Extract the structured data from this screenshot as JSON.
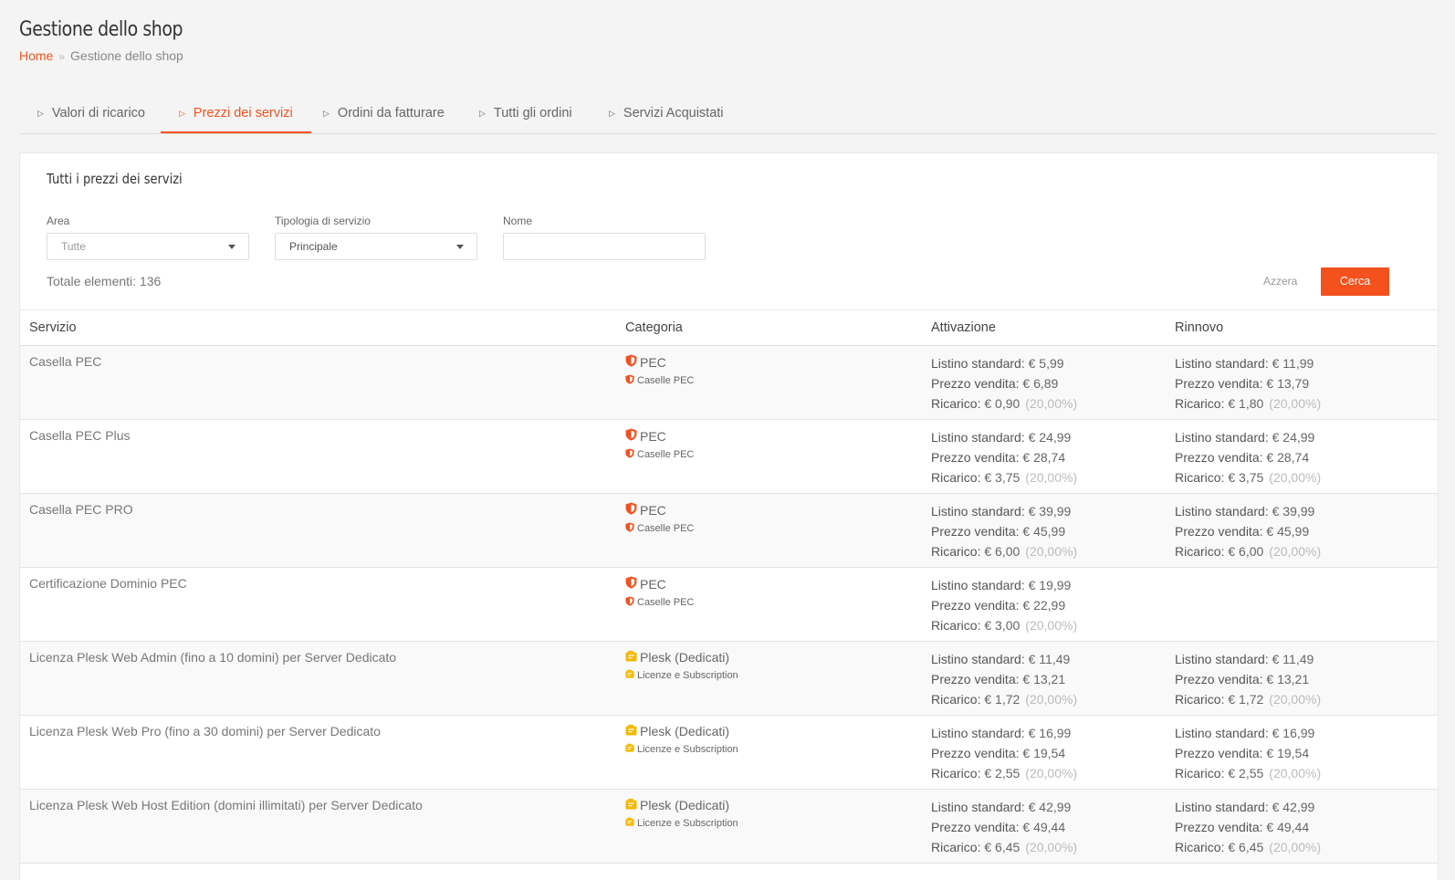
{
  "header": {
    "title": "Gestione dello shop",
    "breadcrumb": {
      "home": "Home",
      "separator": "»",
      "current": "Gestione dello shop"
    }
  },
  "tabs": [
    {
      "label": "Valori di ricarico",
      "active": false
    },
    {
      "label": "Prezzi dei servizi",
      "active": true
    },
    {
      "label": "Ordini da fatturare",
      "active": false
    },
    {
      "label": "Tutti gli ordini",
      "active": false
    },
    {
      "label": "Servizi Acquistati",
      "active": false
    }
  ],
  "card": {
    "title": "Tutti i prezzi dei servizi"
  },
  "filters": {
    "area": {
      "label": "Area",
      "value": "Tutte"
    },
    "tipologia": {
      "label": "Tipologia di servizio",
      "value": "Principale"
    },
    "nome": {
      "label": "Nome",
      "value": "",
      "placeholder": ""
    }
  },
  "summary": {
    "total_label": "Totale elementi:",
    "total_count": "136"
  },
  "actions": {
    "reset_label": "Azzera",
    "search_label": "Cerca"
  },
  "colors": {
    "accent": "#f4511e",
    "pec_icon": "#f4511e",
    "plesk_icon": "#f5b800"
  },
  "table": {
    "columns": [
      "Servizio",
      "Categoria",
      "Attivazione",
      "Rinnovo"
    ],
    "price_labels": {
      "listino": "Listino standard:",
      "vendita": "Prezzo vendita:",
      "ricarico": "Ricarico:"
    },
    "rows": [
      {
        "servizio": "Casella PEC",
        "categoria": "PEC",
        "sottocategoria": "Caselle PEC",
        "icon": "shield-icon",
        "attivazione": {
          "listino": "€ 5,99",
          "vendita": "€ 6,89",
          "ricarico": "€ 0,90",
          "percentuale": "(20,00%)"
        },
        "rinnovo": {
          "listino": "€ 11,99",
          "vendita": "€ 13,79",
          "ricarico": "€ 1,80",
          "percentuale": "(20,00%)"
        }
      },
      {
        "servizio": "Casella PEC Plus",
        "categoria": "PEC",
        "sottocategoria": "Caselle PEC",
        "icon": "shield-icon",
        "attivazione": {
          "listino": "€ 24,99",
          "vendita": "€ 28,74",
          "ricarico": "€ 3,75",
          "percentuale": "(20,00%)"
        },
        "rinnovo": {
          "listino": "€ 24,99",
          "vendita": "€ 28,74",
          "ricarico": "€ 3,75",
          "percentuale": "(20,00%)"
        }
      },
      {
        "servizio": "Casella PEC PRO",
        "categoria": "PEC",
        "sottocategoria": "Caselle PEC",
        "icon": "shield-icon",
        "attivazione": {
          "listino": "€ 39,99",
          "vendita": "€ 45,99",
          "ricarico": "€ 6,00",
          "percentuale": "(20,00%)"
        },
        "rinnovo": {
          "listino": "€ 39,99",
          "vendita": "€ 45,99",
          "ricarico": "€ 6,00",
          "percentuale": "(20,00%)"
        }
      },
      {
        "servizio": "Certificazione Dominio PEC",
        "categoria": "PEC",
        "sottocategoria": "Caselle PEC",
        "icon": "shield-icon",
        "attivazione": {
          "listino": "€ 19,99",
          "vendita": "€ 22,99",
          "ricarico": "€ 3,00",
          "percentuale": "(20,00%)"
        },
        "rinnovo": null
      },
      {
        "servizio": "Licenza Plesk Web Admin (fino a 10 domini) per Server Dedicato",
        "categoria": "Plesk (Dedicati)",
        "sottocategoria": "Licenze e Subscription",
        "icon": "license-icon",
        "attivazione": {
          "listino": "€ 11,49",
          "vendita": "€ 13,21",
          "ricarico": "€ 1,72",
          "percentuale": "(20,00%)"
        },
        "rinnovo": {
          "listino": "€ 11,49",
          "vendita": "€ 13,21",
          "ricarico": "€ 1,72",
          "percentuale": "(20,00%)"
        }
      },
      {
        "servizio": "Licenza Plesk Web Pro (fino a 30 domini) per Server Dedicato",
        "categoria": "Plesk (Dedicati)",
        "sottocategoria": "Licenze e Subscription",
        "icon": "license-icon",
        "attivazione": {
          "listino": "€ 16,99",
          "vendita": "€ 19,54",
          "ricarico": "€ 2,55",
          "percentuale": "(20,00%)"
        },
        "rinnovo": {
          "listino": "€ 16,99",
          "vendita": "€ 19,54",
          "ricarico": "€ 2,55",
          "percentuale": "(20,00%)"
        }
      },
      {
        "servizio": "Licenza Plesk Web Host Edition (domini illimitati) per Server Dedicato",
        "categoria": "Plesk (Dedicati)",
        "sottocategoria": "Licenze e Subscription",
        "icon": "license-icon",
        "attivazione": {
          "listino": "€ 42,99",
          "vendita": "€ 49,44",
          "ricarico": "€ 6,45",
          "percentuale": "(20,00%)"
        },
        "rinnovo": {
          "listino": "€ 42,99",
          "vendita": "€ 49,44",
          "ricarico": "€ 6,45",
          "percentuale": "(20,00%)"
        }
      }
    ]
  }
}
